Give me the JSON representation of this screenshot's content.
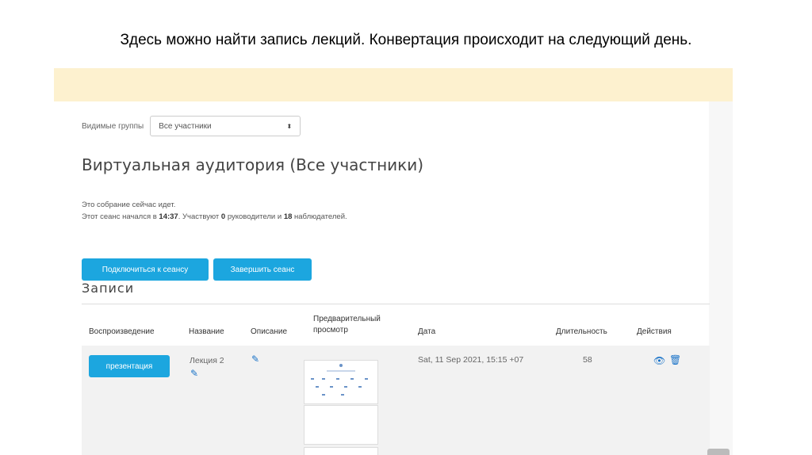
{
  "slide_title": "Здесь можно найти запись лекций.  Конвертация происходит на следующий день.",
  "groups": {
    "label": "Видимые группы",
    "selected": "Все участники"
  },
  "room_title": "Виртуальная аудитория (Все участники)",
  "status": {
    "line1": "Это собрание сейчас идет.",
    "line2_prefix": "Этот сеанс начался в ",
    "start_time": "14:37",
    "line2_mid1": ". Участвуют ",
    "moderators": "0",
    "line2_mid2": " руководители и ",
    "viewers": "18",
    "line2_suffix": " наблюдателей."
  },
  "buttons": {
    "join": "Подключиться к сеансу",
    "end": "Завершить сеанс"
  },
  "records": {
    "heading": "Записи",
    "columns": {
      "playback": "Воспроизведение",
      "name": "Название",
      "description": "Описание",
      "preview_line1": "Предварительный",
      "preview_line2": "просмотр",
      "date": "Дата",
      "duration": "Длительность",
      "actions": "Действия"
    },
    "rows": [
      {
        "playback_button": "презентация",
        "name": "Лекция 2",
        "date": "Sat, 11 Sep 2021, 15:15 +07",
        "duration": "58"
      }
    ]
  },
  "icons": {
    "edit": "pencil-icon",
    "view": "eye-icon",
    "delete": "trash-icon",
    "select": "updown-arrow-icon"
  },
  "colors": {
    "accent": "#1ca6df",
    "banner": "#fdf1cf",
    "link_icon": "#1a73c8"
  }
}
